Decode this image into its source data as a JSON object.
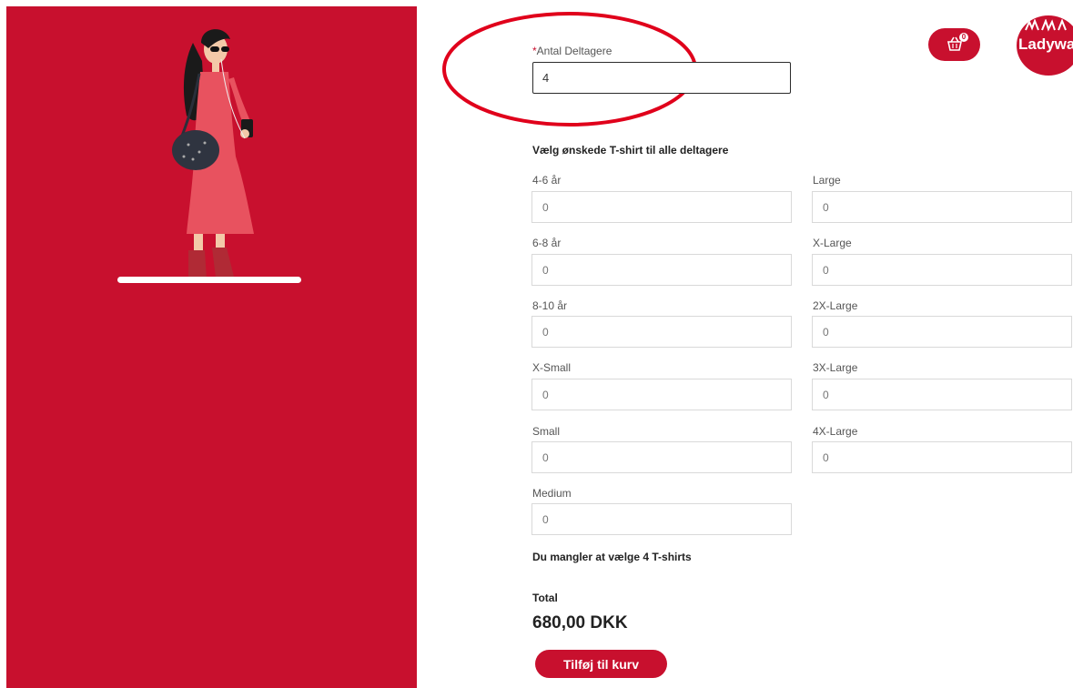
{
  "participants": {
    "required_mark": "*",
    "label": "Antal Deltagere",
    "value": "4"
  },
  "tshirt_heading": "Vælg ønskede T-shirt til alle deltagere",
  "sizes_left": [
    {
      "label": "4-6 år",
      "placeholder": "0"
    },
    {
      "label": "6-8 år",
      "placeholder": "0"
    },
    {
      "label": "8-10 år",
      "placeholder": "0"
    },
    {
      "label": "X-Small",
      "placeholder": "0"
    },
    {
      "label": "Small",
      "placeholder": "0"
    },
    {
      "label": "Medium",
      "placeholder": "0"
    }
  ],
  "sizes_right": [
    {
      "label": "Large",
      "placeholder": "0"
    },
    {
      "label": "X-Large",
      "placeholder": "0"
    },
    {
      "label": "2X-Large",
      "placeholder": "0"
    },
    {
      "label": "3X-Large",
      "placeholder": "0"
    },
    {
      "label": "4X-Large",
      "placeholder": "0"
    }
  ],
  "missing_message": "Du mangler at vælge 4 T-shirts",
  "total": {
    "label": "Total",
    "amount": "680,00 DKK"
  },
  "add_to_cart_label": "Tilføj til kurv",
  "cart": {
    "icon": "basket-icon",
    "count": "0"
  },
  "logo": {
    "text": "Ladywal"
  },
  "colors": {
    "brand_red": "#c8102e",
    "annotation_red": "#e0001b"
  }
}
